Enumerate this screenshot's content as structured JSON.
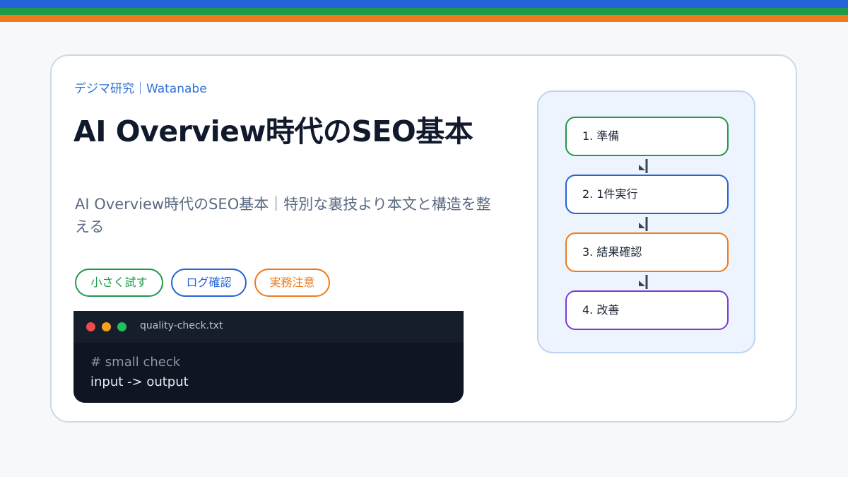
{
  "header_stripes": {
    "colors": [
      "#2563d8",
      "#1f9a4a",
      "#f07a1a"
    ]
  },
  "brand": "デジマ研究｜Watanabe",
  "title": "AI Overview時代のSEO基本",
  "subtitle": "AI Overview時代のSEO基本｜特別な裏技より本文と構造を整える",
  "tags": [
    {
      "label": "小さく試す",
      "color": "#1f9a4a"
    },
    {
      "label": "ログ確認",
      "color": "#2563d8"
    },
    {
      "label": "実務注意",
      "color": "#f07a1a"
    }
  ],
  "code_window": {
    "filename": "quality-check.txt",
    "lines": [
      "# small check",
      "input -> output"
    ]
  },
  "flow": {
    "steps": [
      {
        "label": "1. 準備",
        "color": "#1f9a4a"
      },
      {
        "label": "2. 1件実行",
        "color": "#2563d8"
      },
      {
        "label": "3. 結果確認",
        "color": "#f07a1a"
      },
      {
        "label": "4. 改善",
        "color": "#7c3ad6"
      }
    ],
    "connector_icon": "arrow-down-icon"
  }
}
